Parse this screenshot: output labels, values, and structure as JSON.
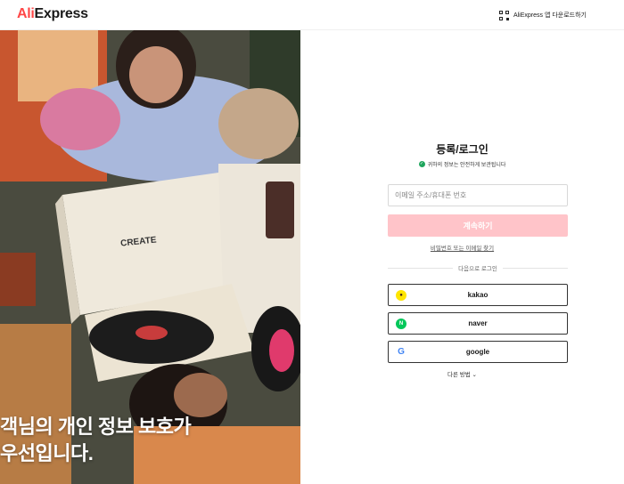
{
  "header": {
    "logo_prefix": "Ali",
    "logo_suffix": "Express",
    "app_download": "AliExpress 앱 다운로드하기"
  },
  "hero": {
    "caption_line1": "객님의 개인 정보 보호가",
    "caption_line2": "우선입니다.",
    "record_player_brand": "CREATE"
  },
  "login": {
    "title": "등록/로그인",
    "secure_note": "귀하의 정보는 안전하게 보관됩니다",
    "email_placeholder": "이메일 주소/휴대폰 번호",
    "continue_label": "계속하기",
    "forgot_link": "비밀번호 또는 이메일 찾기",
    "divider_text": "다음으로 로그인",
    "social": [
      {
        "label": "kakao",
        "icon": "kakao-icon"
      },
      {
        "label": "naver",
        "icon": "naver-icon"
      },
      {
        "label": "google",
        "icon": "google-icon"
      }
    ],
    "more_options": "다른 방법"
  },
  "colors": {
    "brand_red": "#ff4747",
    "continue_disabled": "#ffc4c9",
    "secure_green": "#1fa55d",
    "kakao_yellow": "#fee500",
    "naver_green": "#03c75a"
  }
}
